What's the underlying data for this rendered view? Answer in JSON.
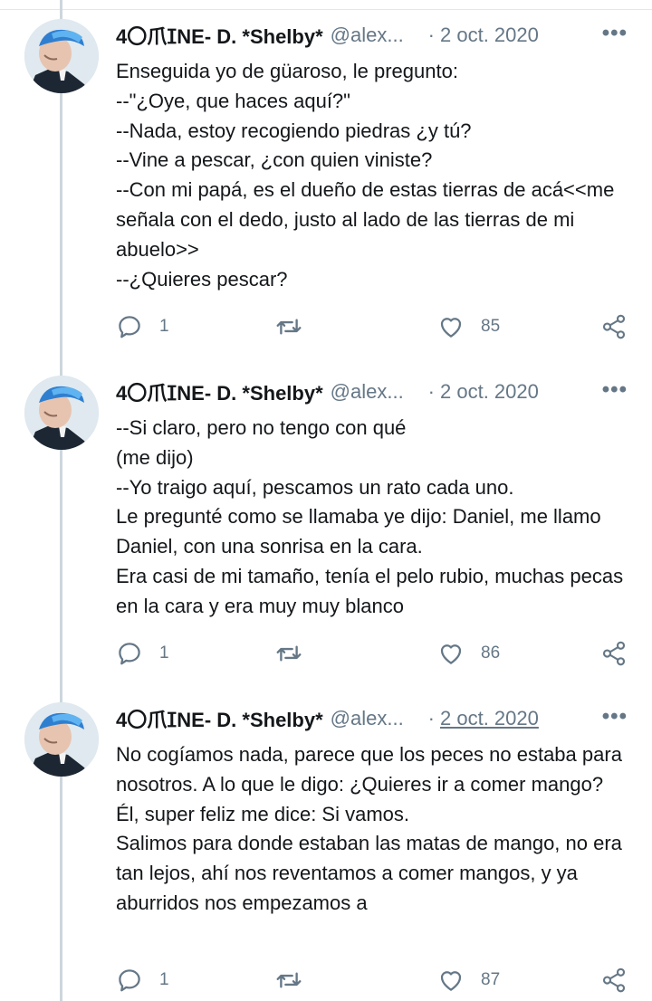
{
  "tweets": [
    {
      "name": "4〇爪ⵊNE- D. *Shelby*",
      "handle": "@alex...",
      "separator": "·",
      "date": "2 oct. 2020",
      "more": "•••",
      "text": "Enseguida yo de güaroso, le pregunto:\n--\"¿Oye, que haces aquí?\"\n--Nada, estoy recogiendo piedras ¿y tú?\n--Vine a pescar, ¿con quien viniste?\n--Con mi papá, es el dueño de estas tierras de acá<<me señala con el dedo, justo al lado de las tierras de mi abuelo>>\n--¿Quieres pescar?",
      "replies": "1",
      "likes": "85"
    },
    {
      "name": "4〇爪ⵊNE- D. *Shelby*",
      "handle": "@alex...",
      "separator": "·",
      "date": "2 oct. 2020",
      "more": "•••",
      "text": "--Si claro, pero no tengo con qué\n(me dijo)\n--Yo traigo aquí, pescamos un rato cada uno.\nLe pregunté como se llamaba ye dijo: Daniel, me llamo Daniel, con una sonrisa en la cara.\nEra casi de mi tamaño, tenía el pelo rubio, muchas pecas en la cara y era muy muy blanco",
      "replies": "1",
      "likes": "86"
    },
    {
      "name": "4〇爪ⵊNE- D. *Shelby*",
      "handle": "@alex...",
      "separator": "·",
      "date": "2 oct. 2020",
      "more": "•••",
      "text": "No cogíamos nada, parece que los peces no estaba para nosotros. A lo que le digo: ¿Quieres ir a comer mango?\nÉl, super feliz me dice: Si vamos.\nSalimos para donde estaban las matas de mango, no era tan lejos, ahí nos reventamos a comer mangos, y ya aburridos nos empezamos a",
      "replies": "1",
      "likes": "87"
    }
  ],
  "icons": {
    "reply": "reply-icon",
    "retweet": "retweet-icon",
    "like": "heart-icon",
    "share": "share-icon",
    "more": "more-icon"
  },
  "colors": {
    "text": "#14171a",
    "secondary": "#657786",
    "thread_line": "#ccd6dd"
  }
}
